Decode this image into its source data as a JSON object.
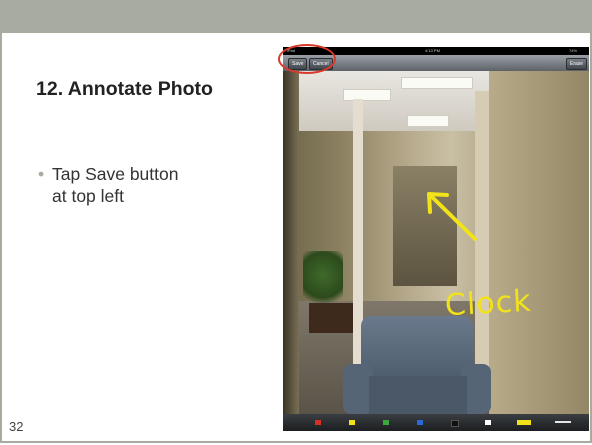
{
  "slide": {
    "title": "12. Annotate Photo",
    "bullet": "Tap Save button at top left",
    "bullet_marker": "•",
    "page_number": "32"
  },
  "device": {
    "status_left": "iPad",
    "status_center": "4:13 PM",
    "status_right": "74%",
    "toolbar": {
      "save_label": "Save",
      "cancel_label": "Cancel",
      "erase_label": "Erase"
    },
    "annotation_text": "Clock",
    "annotation_color": "#f2e21a",
    "palette": [
      {
        "color": "#d83020",
        "name": "red-swatch"
      },
      {
        "color": "#f2e21a",
        "name": "yellow-swatch"
      },
      {
        "color": "#3aa83a",
        "name": "green-swatch"
      },
      {
        "color": "#2a6ad8",
        "name": "blue-swatch"
      },
      {
        "color": "#111111",
        "name": "black-swatch"
      },
      {
        "color": "#ffffff",
        "name": "white-swatch"
      },
      {
        "color": "#f2e21a",
        "name": "highlighter-swatch"
      },
      {
        "color": "#e6e6e6",
        "name": "line-width-swatch"
      }
    ]
  },
  "colors": {
    "header": "#a8aca0",
    "highlight_circle": "#d93a2a"
  }
}
